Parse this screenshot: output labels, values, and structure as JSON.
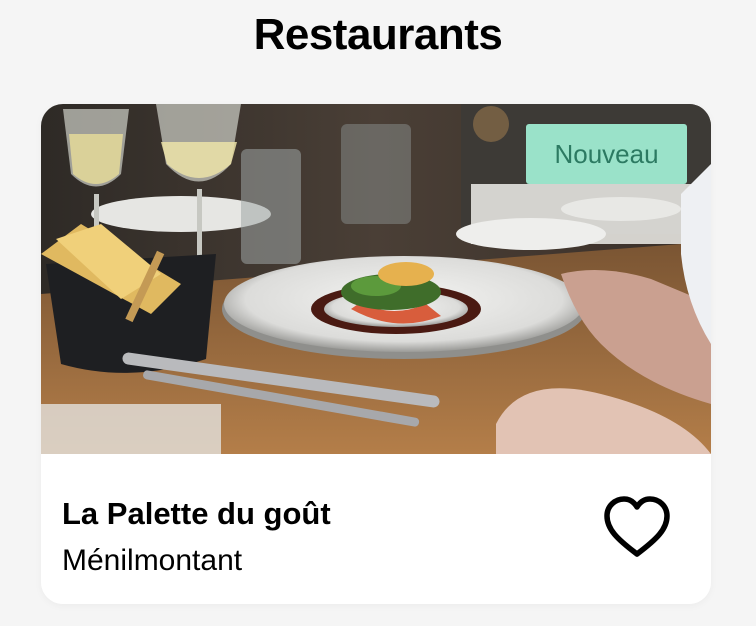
{
  "header": {
    "title": "Restaurants"
  },
  "card": {
    "badge": "Nouveau",
    "name": "La Palette du goût",
    "location": "Ménilmontant",
    "favorite_icon": "heart-outline-icon",
    "badge_color": "#9ae2c9",
    "badge_text_color": "#2c7a62"
  }
}
